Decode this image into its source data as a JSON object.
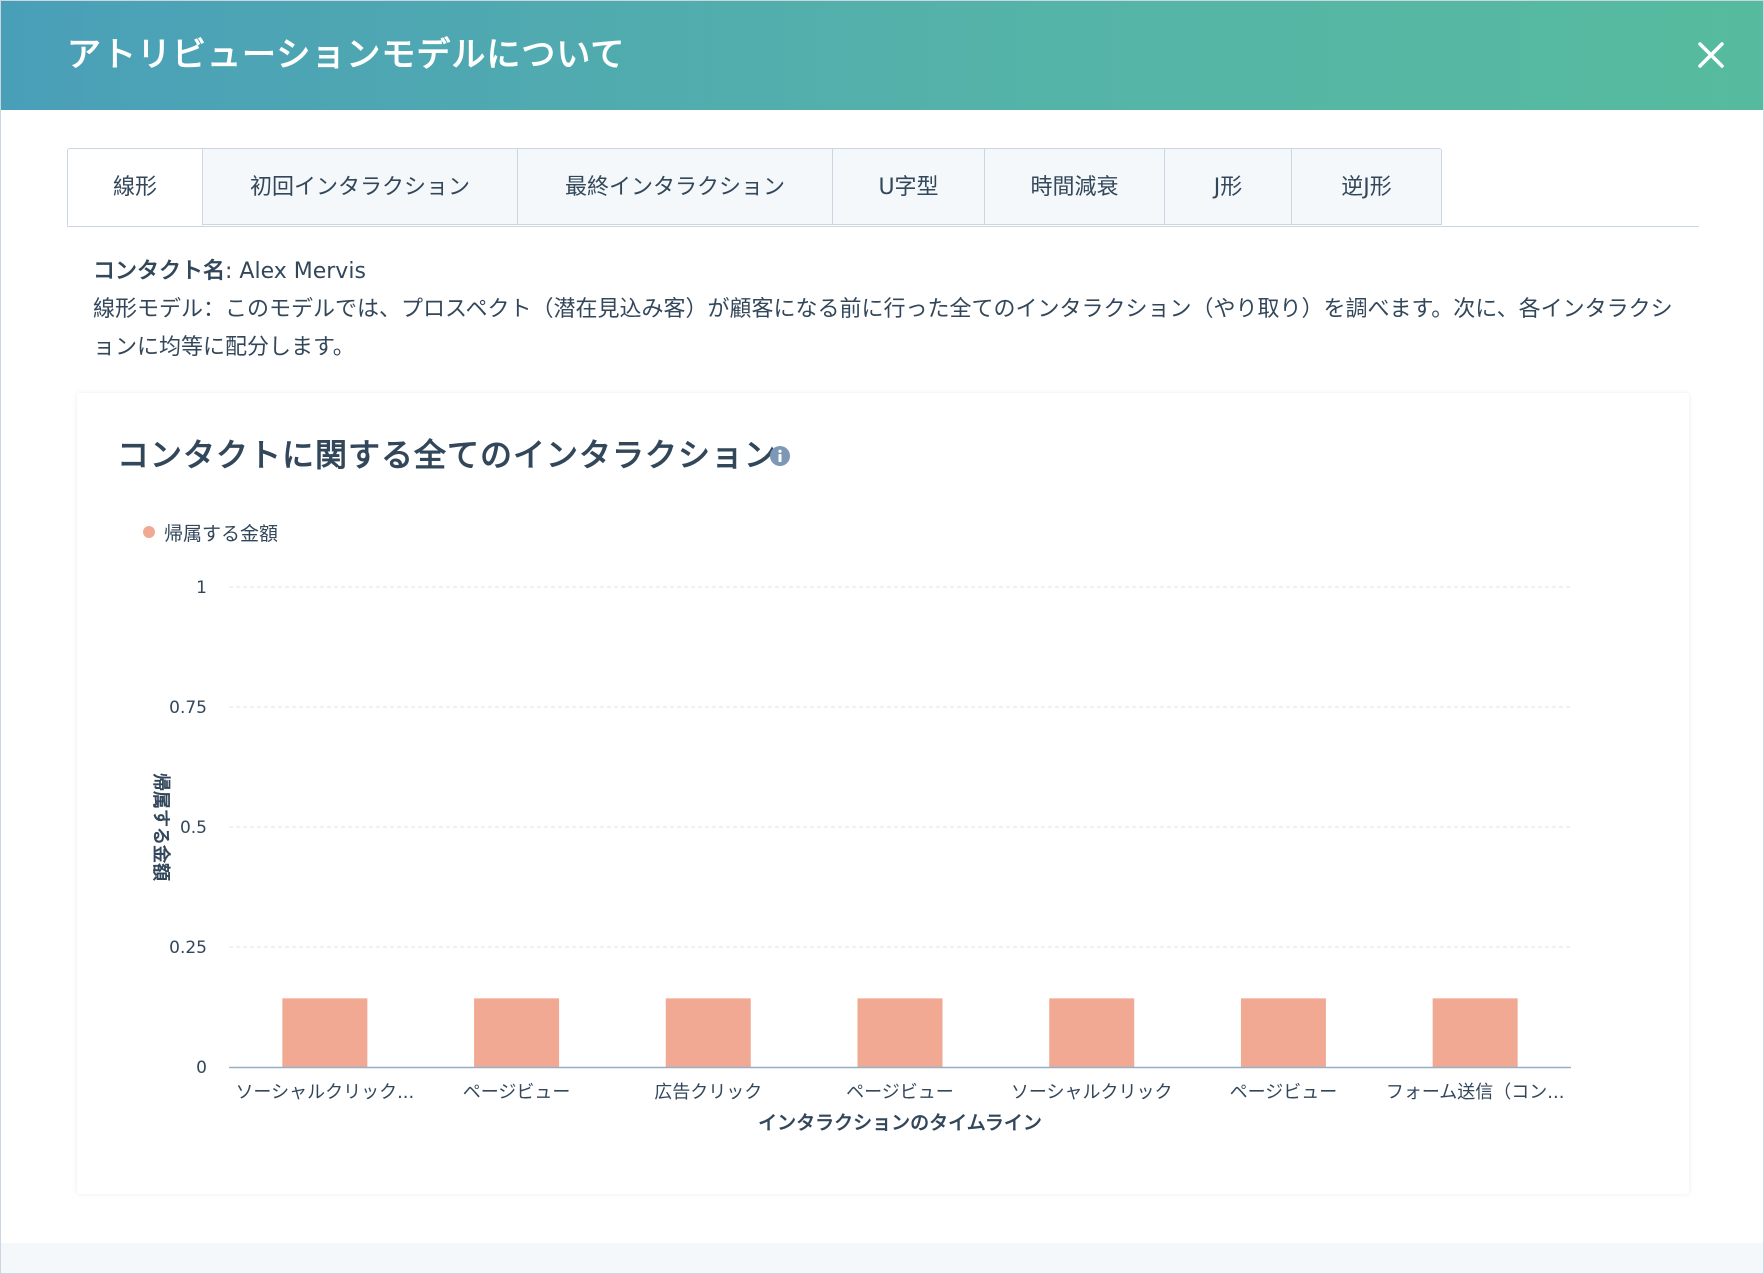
{
  "modal": {
    "title": "アトリビューションモデルについて",
    "close_icon": "close-icon"
  },
  "tabs": [
    {
      "label": "線形",
      "active": true
    },
    {
      "label": "初回インタラクション",
      "active": false
    },
    {
      "label": "最終インタラクション",
      "active": false
    },
    {
      "label": "U字型",
      "active": false
    },
    {
      "label": "時間減衰",
      "active": false
    },
    {
      "label": "J形",
      "active": false
    },
    {
      "label": "逆J形",
      "active": false
    }
  ],
  "description": {
    "contact_label": "コンタクト名",
    "contact_separator": ": ",
    "contact_name": "Alex Mervis",
    "text": "線形モデル：このモデルでは、プロスペクト（潜在見込み客）が顧客になる前に行った全てのインタラクション（やり取り）を調べます。次に、各インタラクションに均等に配分します。"
  },
  "chart_card": {
    "title": "コンタクトに関する全てのインタラクション",
    "info_icon": "info-icon"
  },
  "colors": {
    "bar": "#f2a994",
    "grid": "#dfe3eb",
    "axis": "#99afc4",
    "text": "#33475b",
    "info": "#7c98b6"
  },
  "chart_data": {
    "type": "bar",
    "categories": [
      "ソーシャルクリック...",
      "ページビュー",
      "広告クリック",
      "ページビュー",
      "ソーシャルクリック",
      "ページビュー",
      "フォーム送信（コン..."
    ],
    "series": [
      {
        "name": "帰属する金額",
        "values": [
          0.143,
          0.143,
          0.143,
          0.143,
          0.143,
          0.143,
          0.143
        ]
      }
    ],
    "xlabel": "インタラクションのタイムライン",
    "ylabel": "帰属する金額",
    "ylim": [
      0,
      1
    ],
    "yticks": [
      "0",
      "0.25",
      "0.5",
      "0.75",
      "1"
    ],
    "grid": true,
    "legend": "top-left"
  }
}
